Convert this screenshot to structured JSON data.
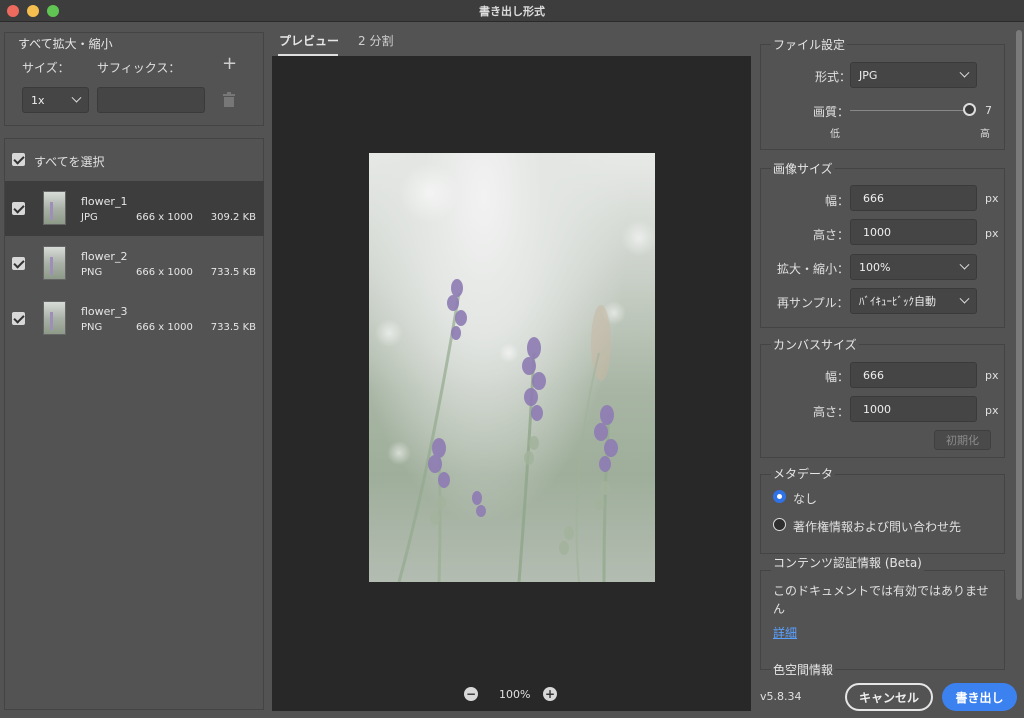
{
  "window": {
    "title": "書き出し形式",
    "traffic_colors": [
      "#ed6a5e",
      "#f5bf4f",
      "#61c554"
    ]
  },
  "scale_all": {
    "title": "すべて拡大・縮小",
    "size_label": "サイズ：",
    "suffix_label": "サフィックス：",
    "size_value": "1x",
    "suffix_value": "",
    "add_icon": "plus-icon",
    "delete_icon": "trash-icon"
  },
  "file_list": {
    "select_all_label": "すべてを選択",
    "items": [
      {
        "name": "flower_1",
        "type": "JPG",
        "dims": "666 x 1000",
        "size": "309.2 KB",
        "checked": true,
        "selected": true
      },
      {
        "name": "flower_2",
        "type": "PNG",
        "dims": "666 x 1000",
        "size": "733.5 KB",
        "checked": true,
        "selected": false
      },
      {
        "name": "flower_3",
        "type": "PNG",
        "dims": "666 x 1000",
        "size": "733.5 KB",
        "checked": true,
        "selected": false
      }
    ]
  },
  "preview": {
    "tabs": [
      {
        "label": "プレビュー",
        "active": true
      },
      {
        "label": "2 分割",
        "active": false
      }
    ],
    "zoom": "100%",
    "zoom_out_icon": "minus-circle-icon",
    "zoom_in_icon": "plus-circle-icon"
  },
  "file_settings": {
    "title": "ファイル設定",
    "format_label": "形式：",
    "format_value": "JPG",
    "quality_label": "画質：",
    "quality_value": "7",
    "quality_low": "低",
    "quality_high": "高",
    "quality_fraction": 1.0
  },
  "image_size": {
    "title": "画像サイズ",
    "width_label": "幅：",
    "width_value": "666",
    "height_label": "高さ：",
    "height_value": "1000",
    "unit": "px",
    "scale_label": "拡大・縮小：",
    "scale_value": "100%",
    "resample_label": "再サンプル：",
    "resample_value": "ﾊﾞｲｷｭｰﾋﾞｯｸ自動"
  },
  "canvas_size": {
    "title": "カンバスサイズ",
    "width_label": "幅：",
    "width_value": "666",
    "height_label": "高さ：",
    "height_value": "1000",
    "unit": "px",
    "reset_label": "初期化"
  },
  "metadata": {
    "title": "メタデータ",
    "option_none": "なし",
    "option_copyright": "著作権情報および問い合わせ先"
  },
  "content_credentials": {
    "title": "コンテンツ認証情報 (Beta)",
    "message": "このドキュメントでは有効ではありません",
    "details_link": "詳細"
  },
  "color_space": {
    "title": "色空間情報"
  },
  "footer": {
    "version": "v5.8.34",
    "cancel_label": "キャンセル",
    "export_label": "書き出し",
    "accent": "#3b82f0"
  }
}
